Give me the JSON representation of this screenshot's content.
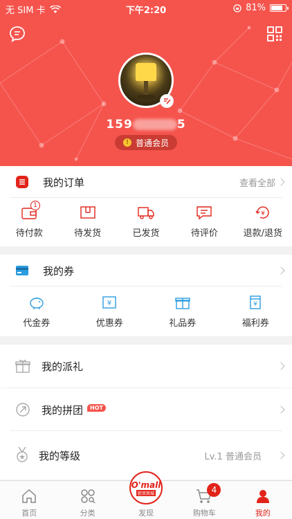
{
  "status_bar": {
    "carrier": "无 SIM 卡",
    "time": "下午2:20",
    "battery": "81%",
    "battery_level": 0.81
  },
  "profile": {
    "phone_visible_prefix": "159",
    "phone_visible_suffix": "5",
    "level": "普通会员"
  },
  "orders": {
    "title": "我的订单",
    "view_all": "查看全部",
    "items": [
      {
        "label": "待付款",
        "icon": "wallet-icon",
        "badge": "1"
      },
      {
        "label": "待发货",
        "icon": "package-icon"
      },
      {
        "label": "已发货",
        "icon": "truck-icon"
      },
      {
        "label": "待评价",
        "icon": "comment-icon"
      },
      {
        "label": "退款/退货",
        "icon": "refund-icon"
      }
    ]
  },
  "coupons": {
    "title": "我的券",
    "items": [
      {
        "label": "代金券",
        "icon": "piggy-bank-icon"
      },
      {
        "label": "优惠券",
        "icon": "yen-ticket-icon"
      },
      {
        "label": "礼品券",
        "icon": "gift-icon"
      },
      {
        "label": "福利券",
        "icon": "yen-card-icon"
      }
    ]
  },
  "list": [
    {
      "title": "我的派礼",
      "icon": "gift-outline-icon"
    },
    {
      "title": "我的拼团",
      "icon": "share-icon",
      "tag": "HOT"
    },
    {
      "title": "我的等级",
      "icon": "medal-icon",
      "value": "Lv.1 普通会员"
    }
  ],
  "tabs": [
    {
      "label": "首页",
      "icon": "home-icon"
    },
    {
      "label": "分类",
      "icon": "category-icon"
    },
    {
      "label": "发现",
      "icon": "omall-icon",
      "logo_text": "O'mall",
      "logo_sub": "欧贸商城"
    },
    {
      "label": "购物车",
      "icon": "cart-icon",
      "badge": "4"
    },
    {
      "label": "我的",
      "icon": "user-icon",
      "active": true
    }
  ],
  "colors": {
    "brand_red": "#f5544d",
    "accent_red": "#e2231a",
    "coupon_blue": "#2a9ce0"
  }
}
